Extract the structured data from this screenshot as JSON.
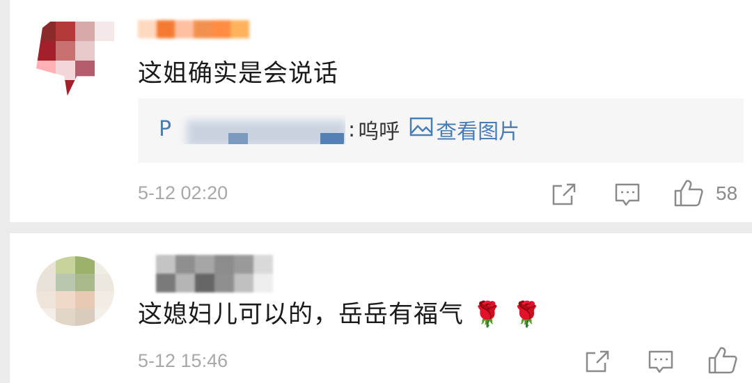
{
  "comments": [
    {
      "text": "这姐确实是会说话",
      "reply": {
        "user_visible": "P",
        "separator": ":",
        "text": "呜呼",
        "view_image_label": "查看图片"
      },
      "time": "5-12 02:20",
      "like_count": "58",
      "avatar_colors": [
        "#8a2a2a",
        "#b33a3a",
        "#d9a8a8",
        "#f3e7e7",
        "#a31f2a",
        "#c97070",
        "#e8c9c9",
        "#ffffff",
        "#ffb0b5",
        "#f2d6da",
        "#b35c6c",
        "#ffffff",
        "#ffffff",
        "#a61e2a",
        "#ffffff",
        "#ffffff"
      ],
      "username_colors": [
        "#ffd9bf",
        "#f47a32",
        "#ffbfa0",
        "#f2914e",
        "#ff8c42",
        "#ffb25c"
      ]
    },
    {
      "text": "这媳妇儿可以的，岳岳有福气 🌹 🌹",
      "time": "5-12 15:46",
      "avatar_colors": [
        "#e9e3d7",
        "#c6d39a",
        "#9cb26a",
        "#f0ede5",
        "#e8e2d8",
        "#b9c7b0",
        "#aab98a",
        "#ede8de",
        "#eee4d9",
        "#f0d9c8",
        "#e7cab4",
        "#f2ece4",
        "#f3efe8",
        "#e2d6c8",
        "#d9ccbd",
        "#f3efe9"
      ],
      "username_colors": [
        "#c4c4c4",
        "#8f8f8f",
        "#a6a6a6",
        "#8c8c8c",
        "#9a9a9a",
        "#d9d9d9",
        "#7a7a7a",
        "#b5b5b5",
        "#666666",
        "#8f8f8f",
        "#c0c0c0",
        "#eeeeee"
      ]
    }
  ],
  "colors": {
    "link": "#4a7cb4",
    "time": "#a8a8a8",
    "icon": "#8a8a8a"
  },
  "icons": {
    "share": "share-icon",
    "reply": "comment-icon",
    "like": "thumbs-up-icon",
    "image": "image-icon"
  }
}
